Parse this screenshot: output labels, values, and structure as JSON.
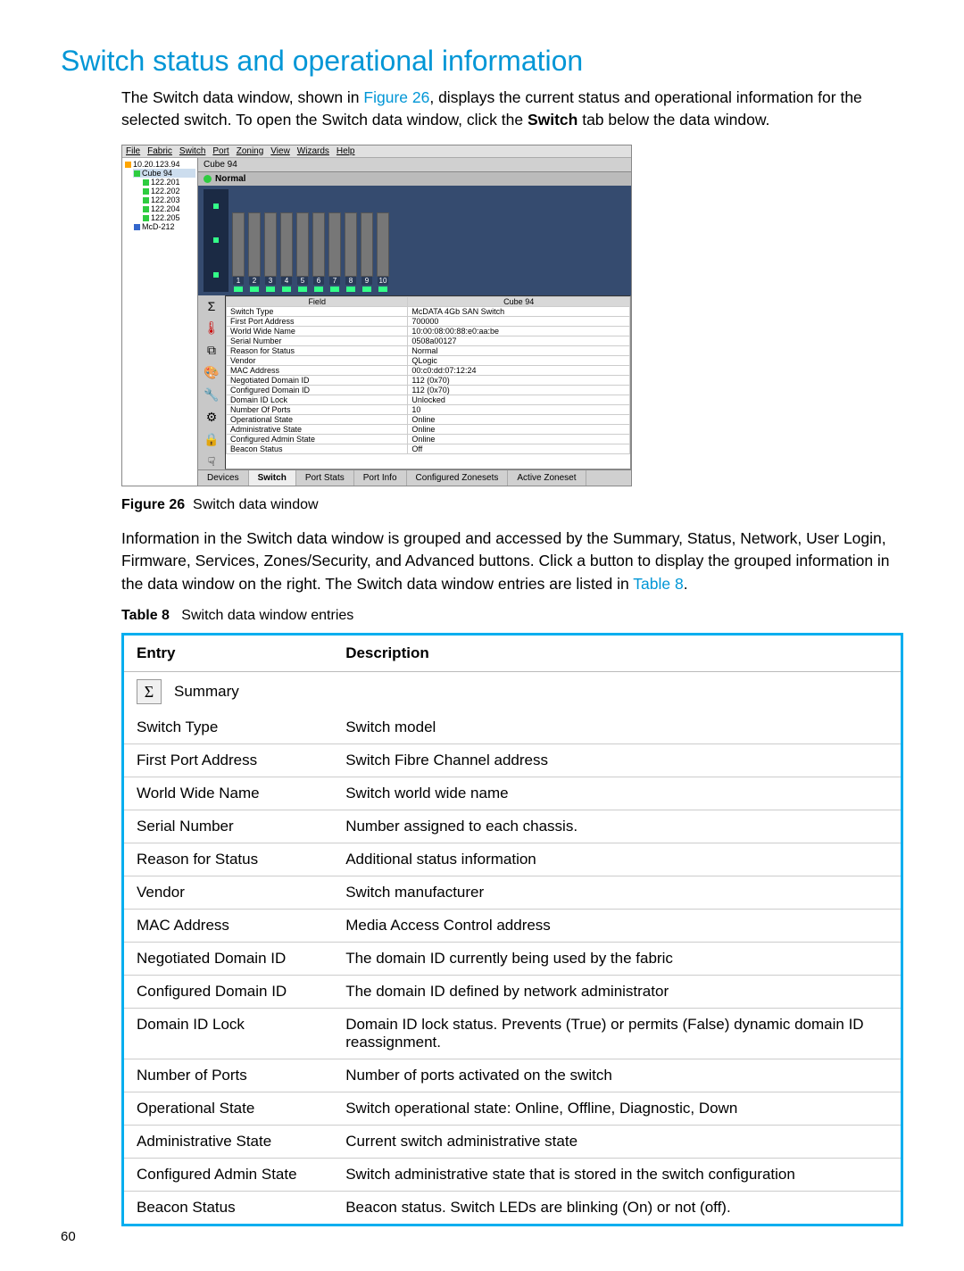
{
  "title": "Switch status and operational information",
  "intro": {
    "pre": "The Switch data window, shown in ",
    "figref": "Figure 26",
    "mid": ", displays the current status and operational information for the selected switch. To open the Switch data window, click the ",
    "bold": "Switch",
    "post": " tab below the data window."
  },
  "screenshot": {
    "menus": [
      "File",
      "Fabric",
      "Switch",
      "Port",
      "Zoning",
      "View",
      "Wizards",
      "Help"
    ],
    "tree": {
      "root": "10.20.123.94",
      "items": [
        "Cube 94",
        "122.201",
        "122.202",
        "122.203",
        "122.204",
        "122.205",
        "McD-212"
      ],
      "selected": "Cube 94"
    },
    "switch_name": "Cube 94",
    "status_text": "Normal",
    "port_numbers": [
      "1",
      "2",
      "3",
      "4",
      "5",
      "6",
      "7",
      "8",
      "9",
      "10"
    ],
    "sidebar_icon_labels": [
      "summary",
      "temperature",
      "network",
      "color",
      "wrench",
      "gear",
      "lock",
      "hand"
    ],
    "data_header": {
      "field": "Field",
      "value_col": "Cube 94"
    },
    "fields": [
      {
        "f": "Switch Type",
        "v": "McDATA 4Gb SAN Switch"
      },
      {
        "f": "First Port Address",
        "v": "700000"
      },
      {
        "f": "World Wide Name",
        "v": "10:00:08:00:88:e0:aa:be"
      },
      {
        "f": "Serial Number",
        "v": "0508a00127"
      },
      {
        "f": "Reason for Status",
        "v": "Normal"
      },
      {
        "f": "Vendor",
        "v": "QLogic"
      },
      {
        "f": "MAC Address",
        "v": "00:c0:dd:07:12:24"
      },
      {
        "f": "Negotiated Domain ID",
        "v": "112 (0x70)"
      },
      {
        "f": "Configured Domain ID",
        "v": "112 (0x70)"
      },
      {
        "f": "Domain ID Lock",
        "v": "Unlocked"
      },
      {
        "f": "Number Of Ports",
        "v": "10"
      },
      {
        "f": "Operational State",
        "v": "Online"
      },
      {
        "f": "Administrative State",
        "v": "Online"
      },
      {
        "f": "Configured Admin State",
        "v": "Online"
      },
      {
        "f": "Beacon Status",
        "v": "Off"
      }
    ],
    "tabs": [
      "Devices",
      "Switch",
      "Port Stats",
      "Port Info",
      "Configured Zonesets",
      "Active Zoneset"
    ],
    "active_tab": "Switch"
  },
  "fig_caption": {
    "label": "Figure 26",
    "text": "Switch data window"
  },
  "para2": {
    "pre": "Information in the Switch data window is grouped and accessed by the Summary, Status, Network, User Login, Firmware, Services, Zones/Security, and Advanced buttons. Click a button to display the grouped information in the data window on the right. The Switch data window entries are listed in ",
    "tblref": "Table 8",
    "post": "."
  },
  "tbl_caption": {
    "label": "Table 8",
    "text": "Switch data window entries"
  },
  "desc_table": {
    "headers": {
      "entry": "Entry",
      "desc": "Description"
    },
    "summary_label": "Summary",
    "rows": [
      {
        "e": "Switch Type",
        "d": "Switch model"
      },
      {
        "e": "First Port Address",
        "d": "Switch Fibre Channel address"
      },
      {
        "e": "World Wide Name",
        "d": "Switch world wide name"
      },
      {
        "e": "Serial Number",
        "d": "Number assigned to each chassis."
      },
      {
        "e": "Reason for Status",
        "d": "Additional status information"
      },
      {
        "e": "Vendor",
        "d": "Switch manufacturer"
      },
      {
        "e": "MAC Address",
        "d": "Media Access Control address"
      },
      {
        "e": "Negotiated Domain ID",
        "d": "The domain ID currently being used by the fabric"
      },
      {
        "e": "Configured Domain ID",
        "d": "The domain ID defined by network administrator"
      },
      {
        "e": "Domain ID Lock",
        "d": "Domain ID lock status. Prevents (True) or permits (False) dynamic domain ID reassignment."
      },
      {
        "e": "Number of Ports",
        "d": "Number of ports activated on the switch"
      },
      {
        "e": "Operational State",
        "d": "Switch operational state: Online, Offline, Diagnostic, Down"
      },
      {
        "e": "Administrative State",
        "d": "Current switch administrative state"
      },
      {
        "e": "Configured Admin State",
        "d": "Switch administrative state that is stored in the switch configuration"
      },
      {
        "e": "Beacon Status",
        "d": "Beacon status. Switch LEDs are blinking (On) or not (off)."
      }
    ]
  },
  "page_number": "60"
}
